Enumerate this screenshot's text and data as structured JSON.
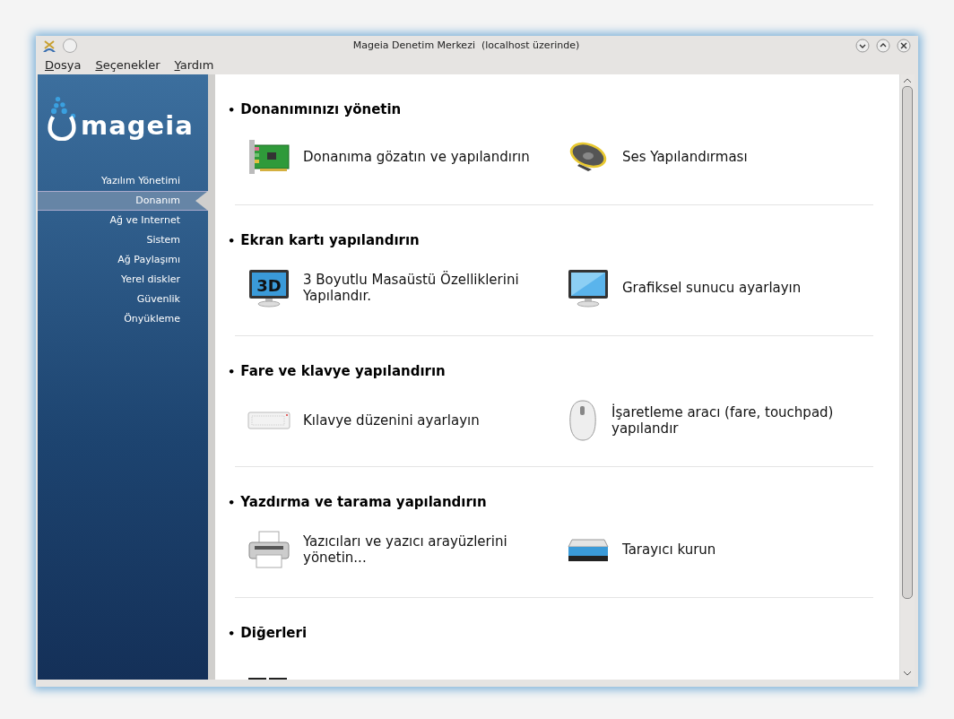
{
  "window": {
    "title": "Mageia Denetim Merkezi  (localhost üzerinde)"
  },
  "menu": [
    "Dosya",
    "Seçenekler",
    "Yardım"
  ],
  "sidebar": {
    "logo_text": "mageia",
    "items": [
      {
        "label": "Yazılım Yönetimi",
        "selected": false
      },
      {
        "label": "Donanım",
        "selected": true
      },
      {
        "label": "Ağ ve Internet",
        "selected": false
      },
      {
        "label": "Sistem",
        "selected": false
      },
      {
        "label": "Ağ Paylaşımı",
        "selected": false
      },
      {
        "label": "Yerel diskler",
        "selected": false
      },
      {
        "label": "Güvenlik",
        "selected": false
      },
      {
        "label": "Önyükleme",
        "selected": false
      }
    ]
  },
  "sections": [
    {
      "bullet": "•",
      "title": "Donanımınızı yönetin",
      "items": [
        {
          "label": "Donanıma gözatın ve yapılandırın"
        },
        {
          "label": "Ses Yapılandırması"
        }
      ]
    },
    {
      "bullet": "•",
      "title": "Ekran kartı yapılandırın",
      "items": [
        {
          "icon_text": "3D",
          "label": "3 Boyutlu Masaüstü Özelliklerini Yapılandır."
        },
        {
          "label": "Grafiksel sunucu ayarlayın"
        }
      ]
    },
    {
      "bullet": "•",
      "title": "Fare ve klavye yapılandırın",
      "items": [
        {
          "label": "Kılavye düzenini ayarlayın"
        },
        {
          "label": "İşaretleme aracı (fare, touchpad) yapılandır"
        }
      ]
    },
    {
      "bullet": "•",
      "title": "Yazdırma ve tarama yapılandırın",
      "items": [
        {
          "label": "Yazıcıları ve yazıcı arayüzlerini yönetin..."
        },
        {
          "label": "Tarayıcı kurun"
        }
      ]
    },
    {
      "bullet": "•",
      "title": "Diğerleri"
    }
  ]
}
